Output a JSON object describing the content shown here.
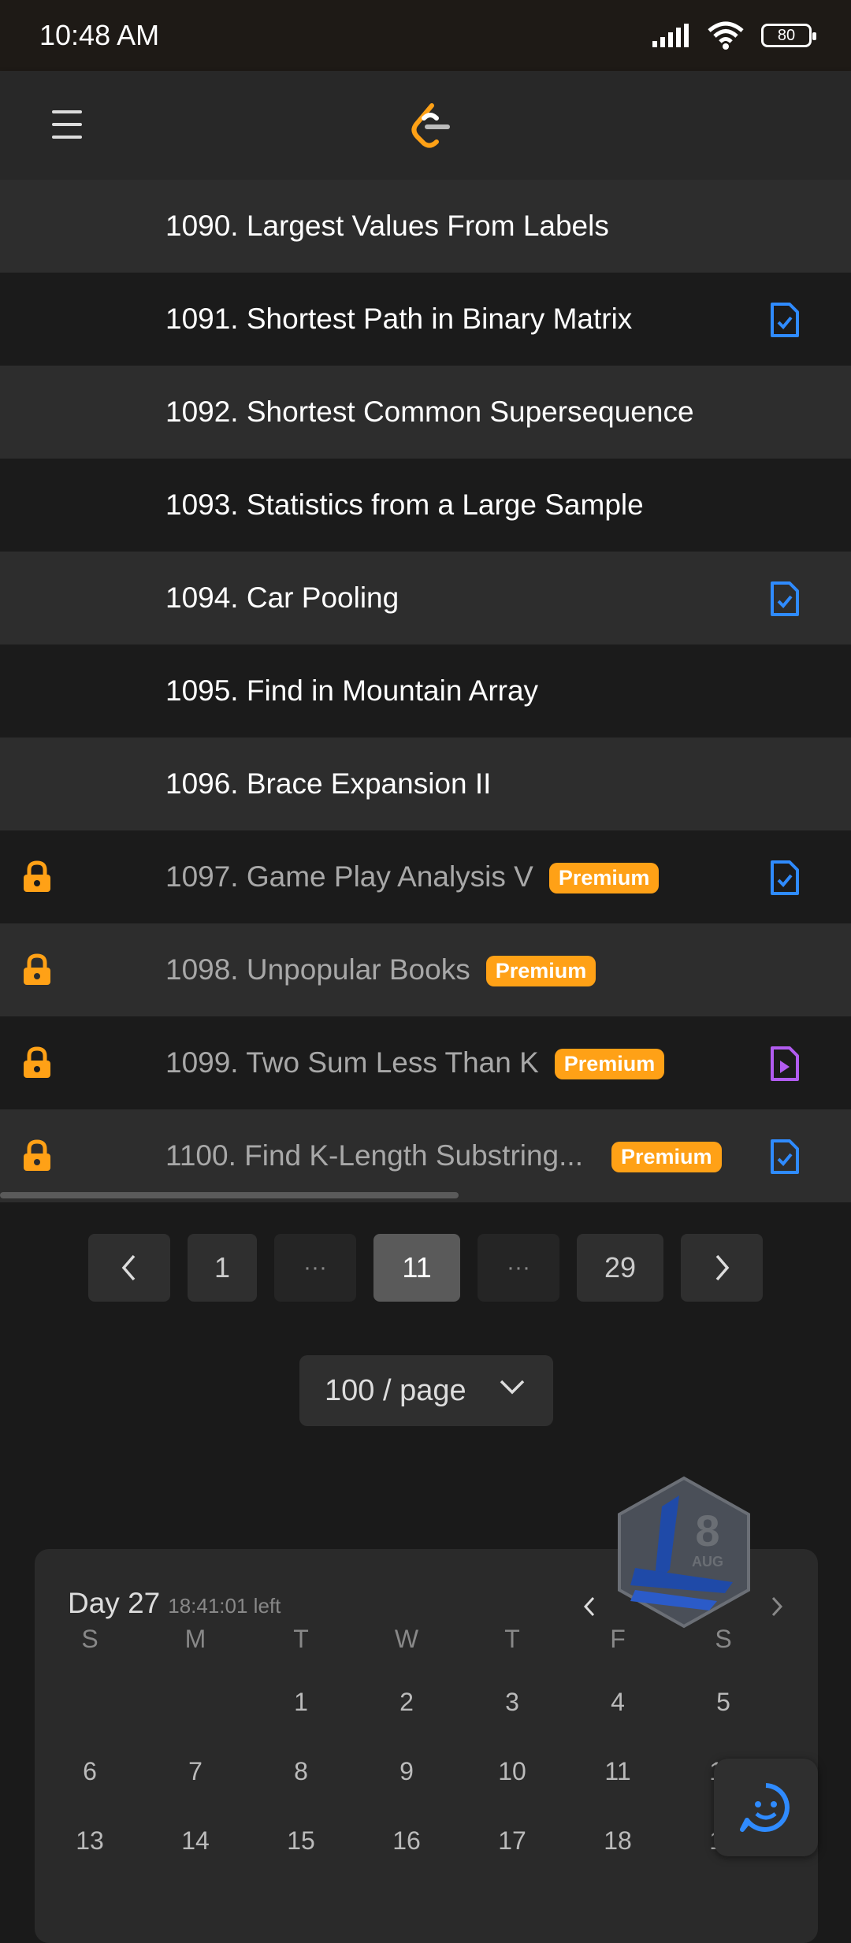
{
  "status": {
    "time": "10:48 AM",
    "battery": "80"
  },
  "problems": [
    {
      "title": "1090. Largest Values From Labels",
      "locked": false,
      "premium": false,
      "icon": ""
    },
    {
      "title": "1091. Shortest Path in Binary Matrix",
      "locked": false,
      "premium": false,
      "icon": "solution-check-icon"
    },
    {
      "title": "1092. Shortest Common Supersequence",
      "locked": false,
      "premium": false,
      "icon": ""
    },
    {
      "title": "1093. Statistics from a Large Sample",
      "locked": false,
      "premium": false,
      "icon": ""
    },
    {
      "title": "1094. Car Pooling",
      "locked": false,
      "premium": false,
      "icon": "solution-check-icon"
    },
    {
      "title": "1095. Find in Mountain Array",
      "locked": false,
      "premium": false,
      "icon": ""
    },
    {
      "title": "1096. Brace Expansion II",
      "locked": false,
      "premium": false,
      "icon": ""
    },
    {
      "title": "1097. Game Play Analysis V",
      "locked": true,
      "premium": true,
      "icon": "solution-check-icon"
    },
    {
      "title": "1098. Unpopular Books",
      "locked": true,
      "premium": true,
      "icon": ""
    },
    {
      "title": "1099. Two Sum Less Than K",
      "locked": true,
      "premium": true,
      "icon": "video-solution-icon"
    },
    {
      "title": "1100. Find K-Length Substring...",
      "locked": true,
      "premium": true,
      "icon": "solution-check-icon"
    }
  ],
  "premium_label": "Premium",
  "pagination": {
    "first": "1",
    "ellipsis": "···",
    "current": "11",
    "last": "29"
  },
  "per_page": "100 / page",
  "calendar": {
    "day_label": "Day 27",
    "time_left": "18:41:01 left",
    "badge_day": "8",
    "badge_month": "AUG",
    "weekdays": [
      "S",
      "M",
      "T",
      "W",
      "T",
      "F",
      "S"
    ],
    "weeks": [
      [
        "",
        "",
        "1",
        "2",
        "3",
        "4",
        "5"
      ],
      [
        "6",
        "7",
        "8",
        "9",
        "10",
        "11",
        "12"
      ],
      [
        "13",
        "14",
        "15",
        "16",
        "17",
        "18",
        "19"
      ]
    ]
  },
  "colors": {
    "accent": "#ffa116",
    "blue_icon": "#2f8bff",
    "purple_icon": "#b25cf0"
  }
}
